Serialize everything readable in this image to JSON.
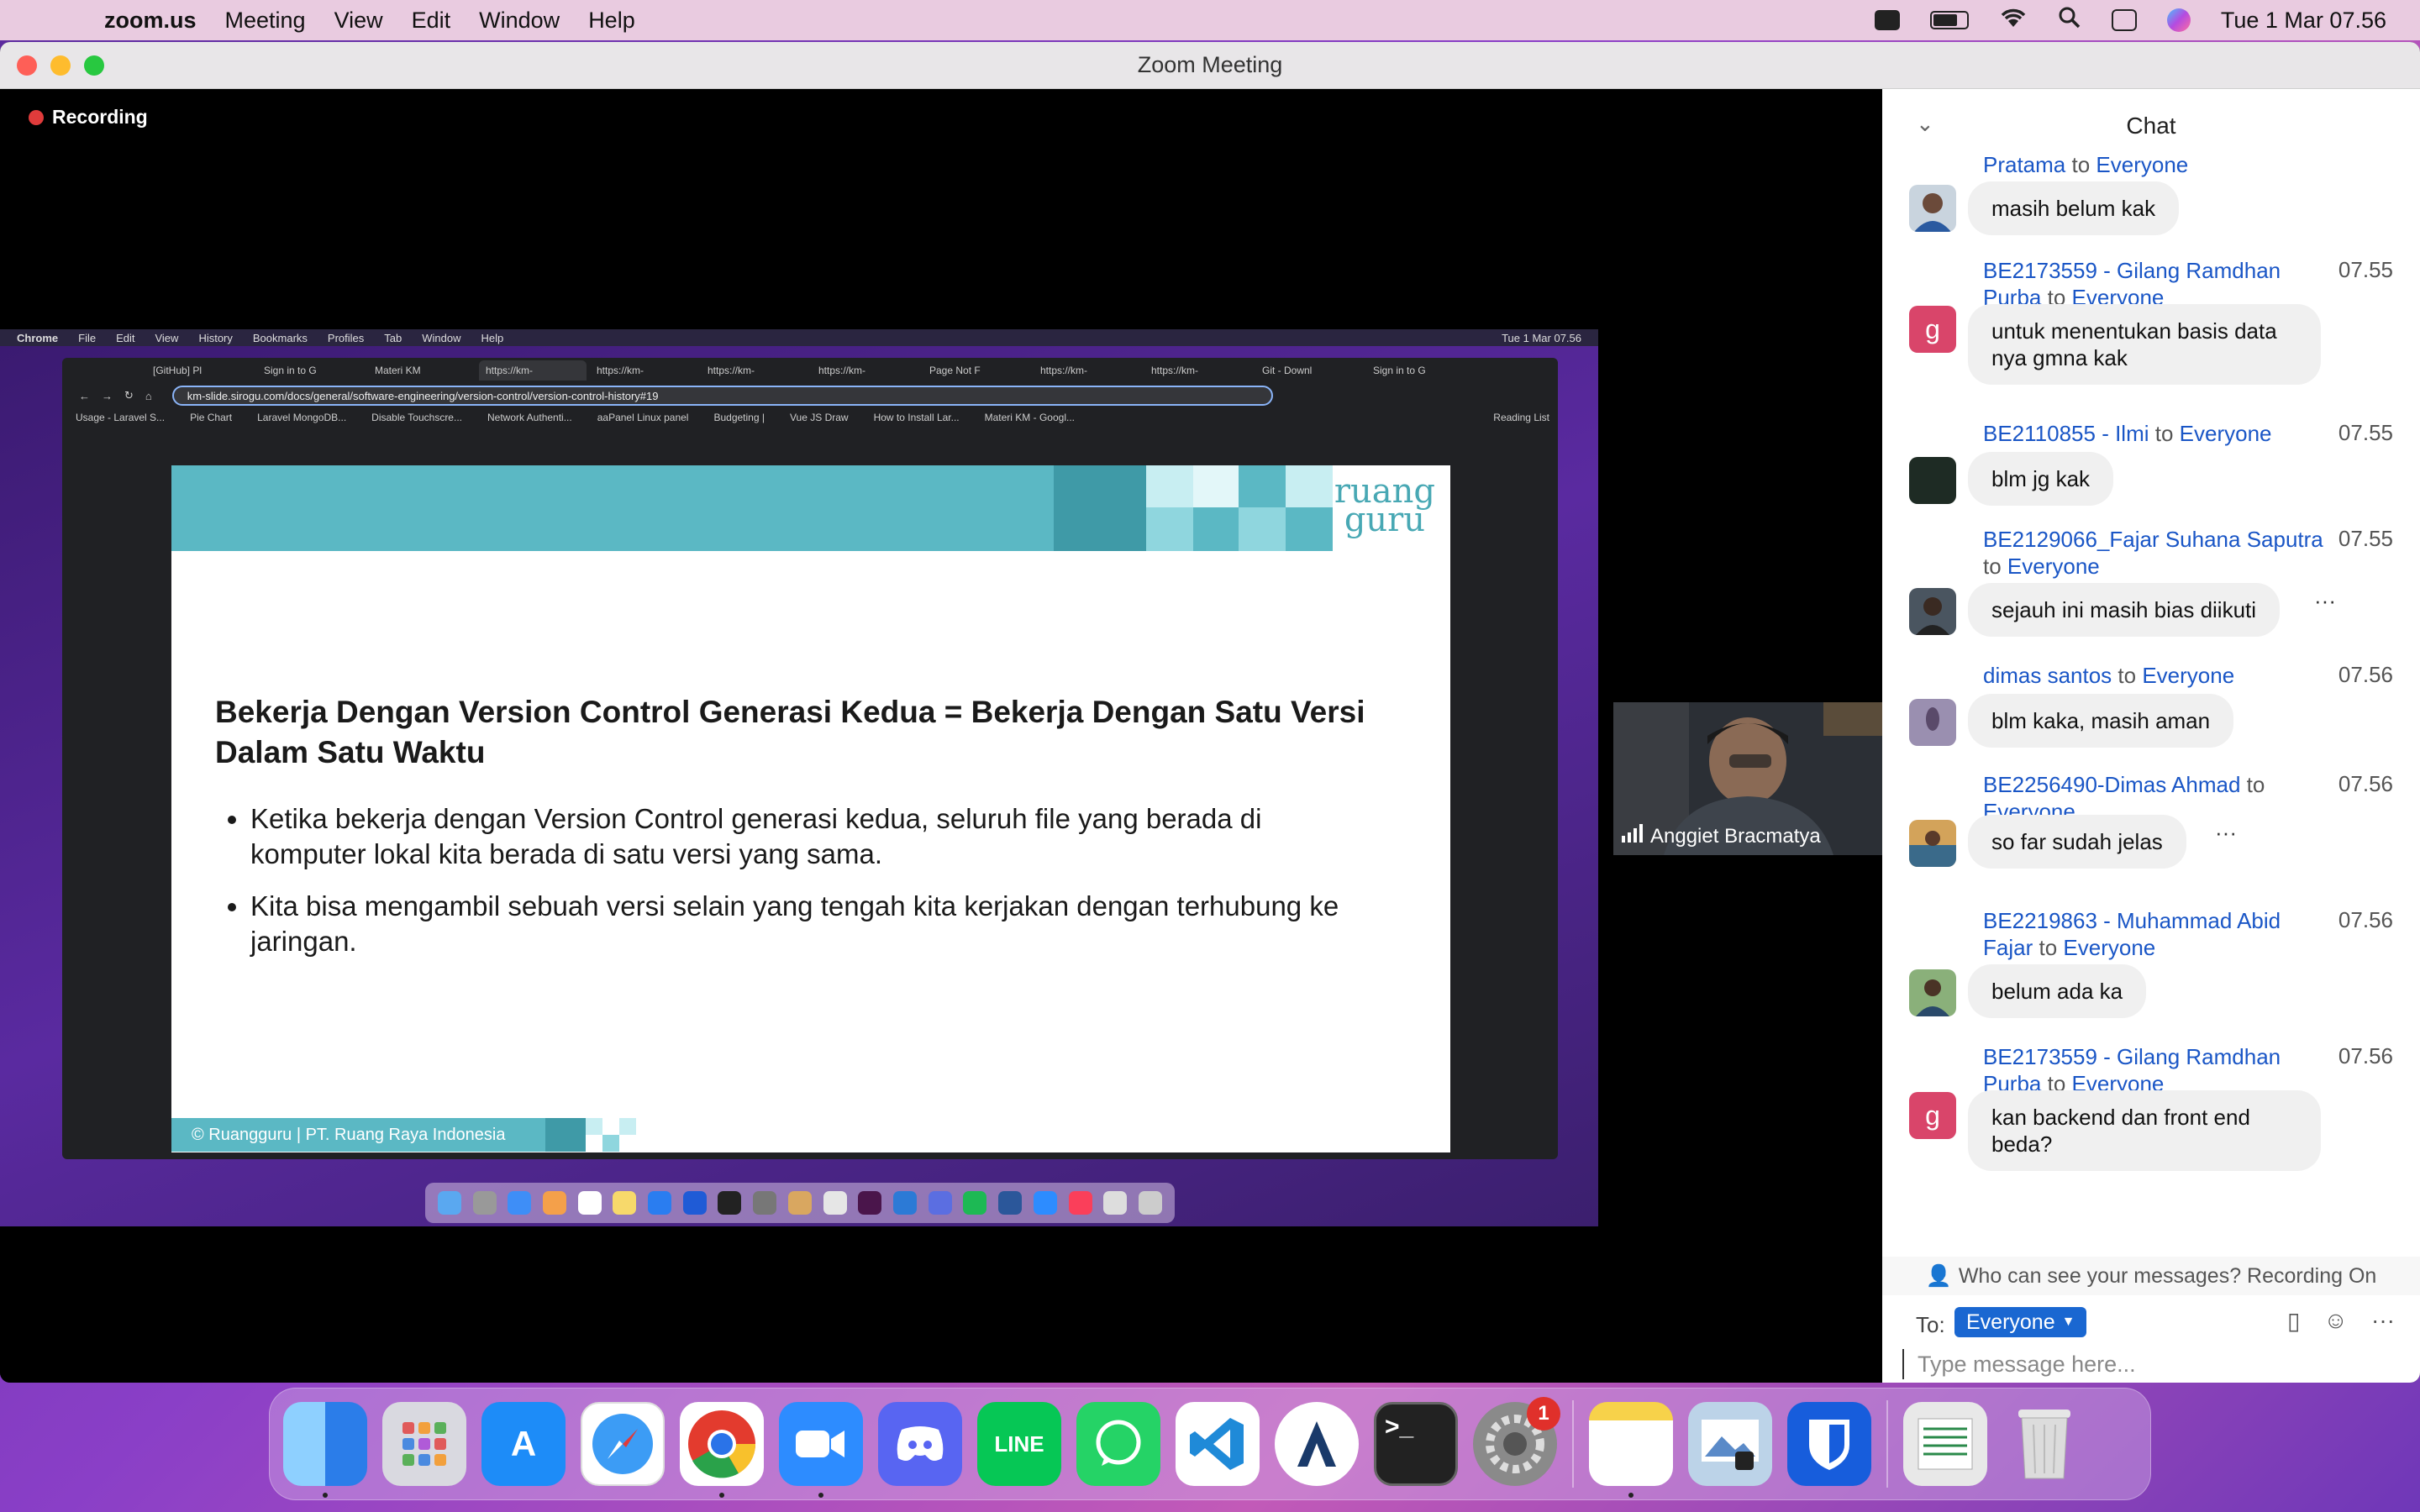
{
  "menubar": {
    "app": "zoom.us",
    "items": [
      "Meeting",
      "View",
      "Edit",
      "Window",
      "Help"
    ],
    "datetime": "Tue 1 Mar  07.56"
  },
  "window": {
    "title": "Zoom Meeting"
  },
  "recording": {
    "label": "Recording"
  },
  "shared": {
    "menubar": {
      "app": "Chrome",
      "items": [
        "File",
        "Edit",
        "View",
        "History",
        "Bookmarks",
        "Profiles",
        "Tab",
        "Window",
        "Help"
      ],
      "datetime": "Tue 1 Mar  07.56"
    },
    "tabs": [
      "[GitHub] Pl",
      "Sign in to G",
      "Materi KM",
      "https://km-",
      "https://km-",
      "https://km-",
      "https://km-",
      "Page Not F",
      "https://km-",
      "https://km-",
      "Git - Downl",
      "Sign in to G"
    ],
    "url": "km-slide.sirogu.com/docs/general/software-engineering/version-control/version-control-history#19",
    "bookmarks": [
      "Usage - Laravel S...",
      "Pie Chart",
      "Laravel MongoDB...",
      "Disable Touchscre...",
      "Network Authenti...",
      "aaPanel Linux panel",
      "Budgeting |",
      "Vue JS Draw",
      "How to Install Lar...",
      "Materi KM - Googl...",
      "Reading List"
    ],
    "slide": {
      "logo_line1": "ruang",
      "logo_line2": "guru",
      "title": "Bekerja Dengan Version Control Generasi Kedua = Bekerja Dengan Satu Versi Dalam Satu Waktu",
      "bullets": [
        "Ketika bekerja dengan Version Control generasi kedua, seluruh file yang berada di komputer lokal kita berada di satu versi yang sama.",
        "Kita bisa mengambil sebuah versi selain yang tengah kita kerjakan dengan terhubung ke jaringan."
      ],
      "footer": "© Ruangguru | PT. Ruang Raya Indonesia"
    }
  },
  "video": {
    "name": "Anggiet Bracmatya"
  },
  "chat": {
    "title": "Chat",
    "messages": [
      {
        "sender": "Pratama",
        "to": "to",
        "target": "Everyone",
        "time": "",
        "text": "masih belum kak"
      },
      {
        "sender": "BE2173559 - Gilang Ramdhan Purba",
        "to": "to",
        "target": "Everyone",
        "time": "07.55",
        "text": "untuk menentukan basis data nya gmna kak"
      },
      {
        "sender": "BE2110855 - Ilmi",
        "to": "to",
        "target": "Everyone",
        "time": "07.55",
        "text": "blm jg kak"
      },
      {
        "sender": "BE2129066_Fajar Suhana Saputra",
        "to": "to",
        "target": "Everyone",
        "time": "07.55",
        "text": "sejauh ini masih bias diikuti"
      },
      {
        "sender": "dimas santos",
        "to": "to",
        "target": "Everyone",
        "time": "07.56",
        "text": "blm kaka, masih aman"
      },
      {
        "sender": "BE2256490-Dimas Ahmad",
        "to": "to",
        "target": "Everyone",
        "time": "07.56",
        "text": "so far sudah jelas"
      },
      {
        "sender": "BE2219863 - Muhammad Abid Fajar",
        "to": "to",
        "target": "Everyone",
        "time": "07.56",
        "text": "belum ada ka"
      },
      {
        "sender": "BE2173559 - Gilang Ramdhan Purba",
        "to": "to",
        "target": "Everyone",
        "time": "07.56",
        "text": "kan backend dan front end beda?"
      }
    ],
    "avatar_letter": "g",
    "privacy": "Who can see your messages? Recording On",
    "to_label": "To:",
    "recipient": "Everyone",
    "placeholder": "Type message here..."
  },
  "dock": {
    "badge": "1"
  },
  "colors": {
    "link": "#1a56c6",
    "teal": "#5bb8c4",
    "recipient": "#1a67d1",
    "badge": "#e0302b"
  }
}
